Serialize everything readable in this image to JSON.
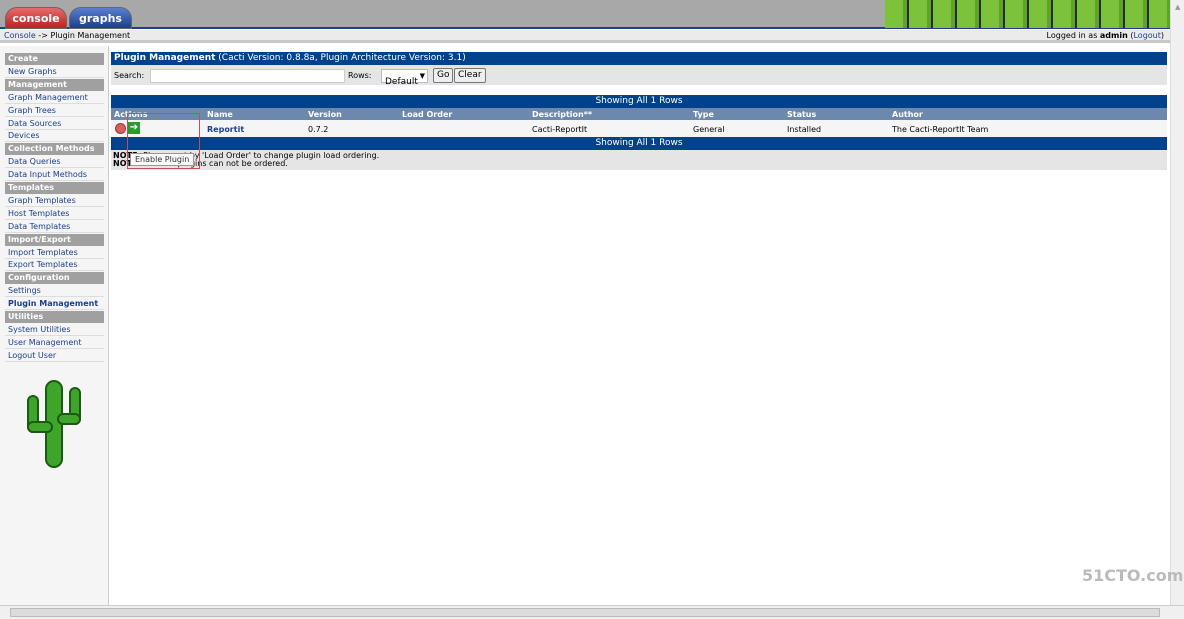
{
  "tabs": [
    "console",
    "graphs"
  ],
  "breadcrumb": {
    "link": "Console",
    "sep": " -> ",
    "current": "Plugin Management"
  },
  "login": {
    "prefix": "Logged in as ",
    "user": "admin",
    "logout": "Logout"
  },
  "sidebar": [
    {
      "t": "h",
      "label": "Create"
    },
    {
      "t": "l",
      "label": "New Graphs"
    },
    {
      "t": "h",
      "label": "Management"
    },
    {
      "t": "l",
      "label": "Graph Management"
    },
    {
      "t": "l",
      "label": "Graph Trees"
    },
    {
      "t": "l",
      "label": "Data Sources"
    },
    {
      "t": "l",
      "label": "Devices"
    },
    {
      "t": "h",
      "label": "Collection Methods"
    },
    {
      "t": "l",
      "label": "Data Queries"
    },
    {
      "t": "l",
      "label": "Data Input Methods"
    },
    {
      "t": "h",
      "label": "Templates"
    },
    {
      "t": "l",
      "label": "Graph Templates"
    },
    {
      "t": "l",
      "label": "Host Templates"
    },
    {
      "t": "l",
      "label": "Data Templates"
    },
    {
      "t": "h",
      "label": "Import/Export"
    },
    {
      "t": "l",
      "label": "Import Templates"
    },
    {
      "t": "l",
      "label": "Export Templates"
    },
    {
      "t": "h",
      "label": "Configuration"
    },
    {
      "t": "l",
      "label": "Settings"
    },
    {
      "t": "l",
      "label": "Plugin Management",
      "current": true
    },
    {
      "t": "h",
      "label": "Utilities"
    },
    {
      "t": "l",
      "label": "System Utilities"
    },
    {
      "t": "l",
      "label": "User Management"
    },
    {
      "t": "l",
      "label": "Logout User"
    }
  ],
  "panel": {
    "title": "Plugin Management",
    "subtitle": " (Cacti Version: 0.8.8a, Plugin Architecture Version: 3.1)"
  },
  "filter": {
    "search_label": "Search:",
    "search_value": "",
    "rows_label": "Rows:",
    "rows_value": "Default",
    "go": "Go",
    "clear": "Clear"
  },
  "table": {
    "showing": "Showing All 1 Rows",
    "columns": [
      "Actions",
      "Name",
      "Version",
      "Load Order",
      "Description**",
      "Type",
      "Status",
      "Author"
    ],
    "rows": [
      {
        "name": "Reportit",
        "version": "0.7.2",
        "load_order": "",
        "description": "Cacti-ReportIt",
        "type": "General",
        "status": "Installed",
        "author": "The Cacti-ReportIt Team"
      }
    ]
  },
  "notes": [
    {
      "b": "NOTE:",
      "t": " Please sort by 'Load Order' to change plugin load ordering."
    },
    {
      "b": "NOTE:",
      "t": " SYSTEM plugins can not be ordered."
    }
  ],
  "tooltip": "Enable Plugin",
  "watermark": "51CTO.com"
}
